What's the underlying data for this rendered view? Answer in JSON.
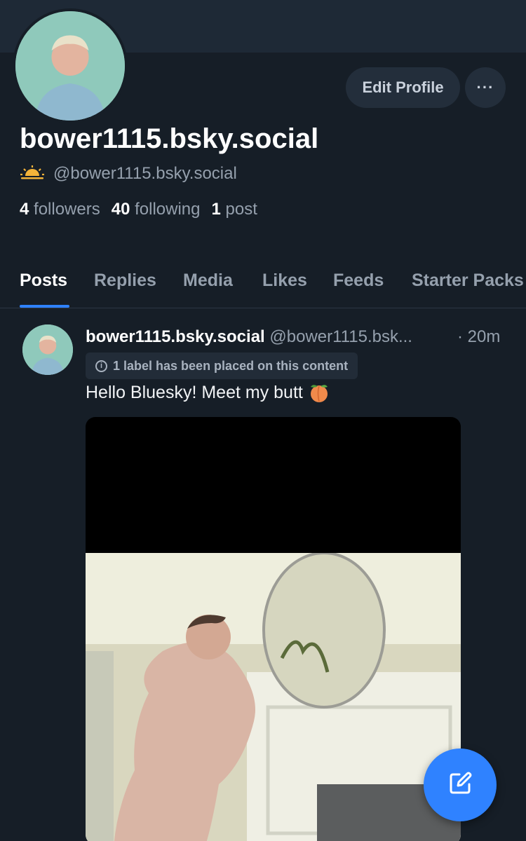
{
  "profile": {
    "display_name": "bower1115.bsky.social",
    "handle": "@bower1115.bsky.social",
    "status_icon": "sunrise-icon",
    "stats": {
      "followers_count": "4",
      "followers_label": "followers",
      "following_count": "40",
      "following_label": "following",
      "posts_count": "1",
      "posts_label": "post"
    },
    "edit_label": "Edit Profile",
    "more_label": "···"
  },
  "tabs": [
    "Posts",
    "Replies",
    "Media",
    "Likes",
    "Feeds",
    "Starter Packs"
  ],
  "active_tab": "Posts",
  "post": {
    "author_name": "bower1115.bsky.social",
    "author_handle": "@bower1115.bsk...",
    "time": "· 20m",
    "label_notice": "1 label has been placed on this content",
    "text": "Hello Bluesky! Meet my butt",
    "emoji_icon": "peach-icon"
  },
  "colors": {
    "background": "#161e27",
    "banner": "#1e2936",
    "accent": "#2f82ff",
    "muted_text": "#95a0ad"
  }
}
